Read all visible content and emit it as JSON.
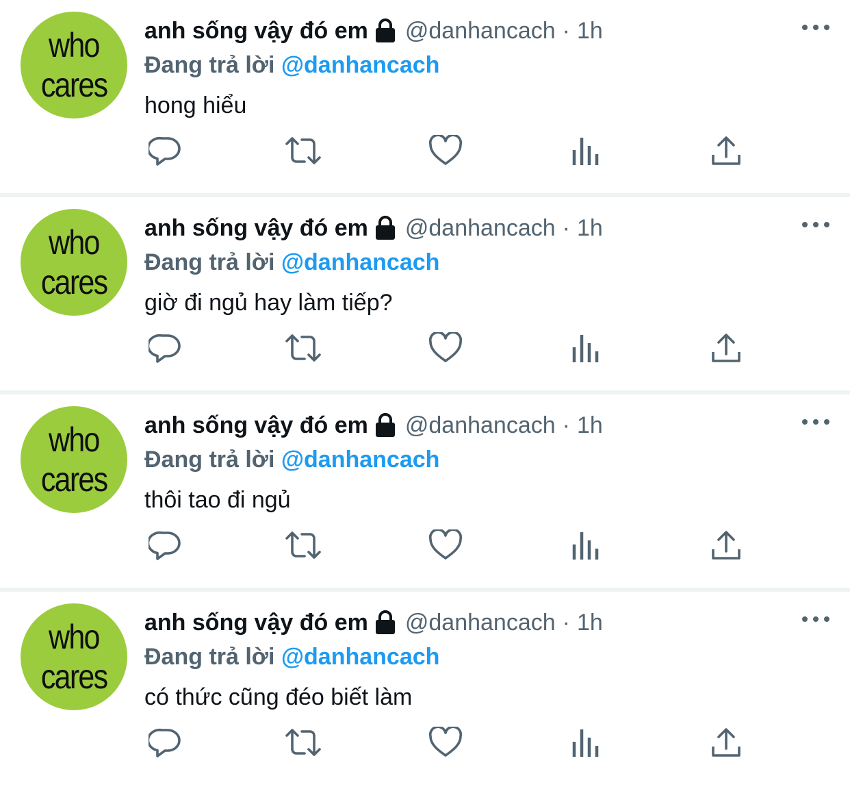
{
  "tweets": [
    {
      "avatar": {
        "line1": "who",
        "line2": "cares"
      },
      "name": "anh sống vậy đó em",
      "handle": "@danhancach",
      "dot": "·",
      "time": "1h",
      "replying_prefix": "Đang trả lời",
      "replying_to": "@danhancach",
      "text": "hong hiểu"
    },
    {
      "avatar": {
        "line1": "who",
        "line2": "cares"
      },
      "name": "anh sống vậy đó em",
      "handle": "@danhancach",
      "dot": "·",
      "time": "1h",
      "replying_prefix": "Đang trả lời",
      "replying_to": "@danhancach",
      "text": "giờ đi ngủ hay làm tiếp?"
    },
    {
      "avatar": {
        "line1": "who",
        "line2": "cares"
      },
      "name": "anh sống vậy đó em",
      "handle": "@danhancach",
      "dot": "·",
      "time": "1h",
      "replying_prefix": "Đang trả lời",
      "replying_to": "@danhancach",
      "text": "thôi tao đi ngủ"
    },
    {
      "avatar": {
        "line1": "who",
        "line2": "cares"
      },
      "name": "anh sống vậy đó em",
      "handle": "@danhancach",
      "dot": "·",
      "time": "1h",
      "replying_prefix": "Đang trả lời",
      "replying_to": "@danhancach",
      "text": "có thức cũng đéo biết làm"
    }
  ],
  "icons": {
    "verified": "lock-icon",
    "more": "more-icon",
    "actions": [
      "reply-icon",
      "retweet-icon",
      "like-icon",
      "views-icon",
      "share-icon"
    ]
  },
  "colors": {
    "text": "#0f1419",
    "secondary": "#536471",
    "mention": "#1d9bf0",
    "avatar_bg": "#9bcc3d",
    "divider": "#eff3f4"
  }
}
